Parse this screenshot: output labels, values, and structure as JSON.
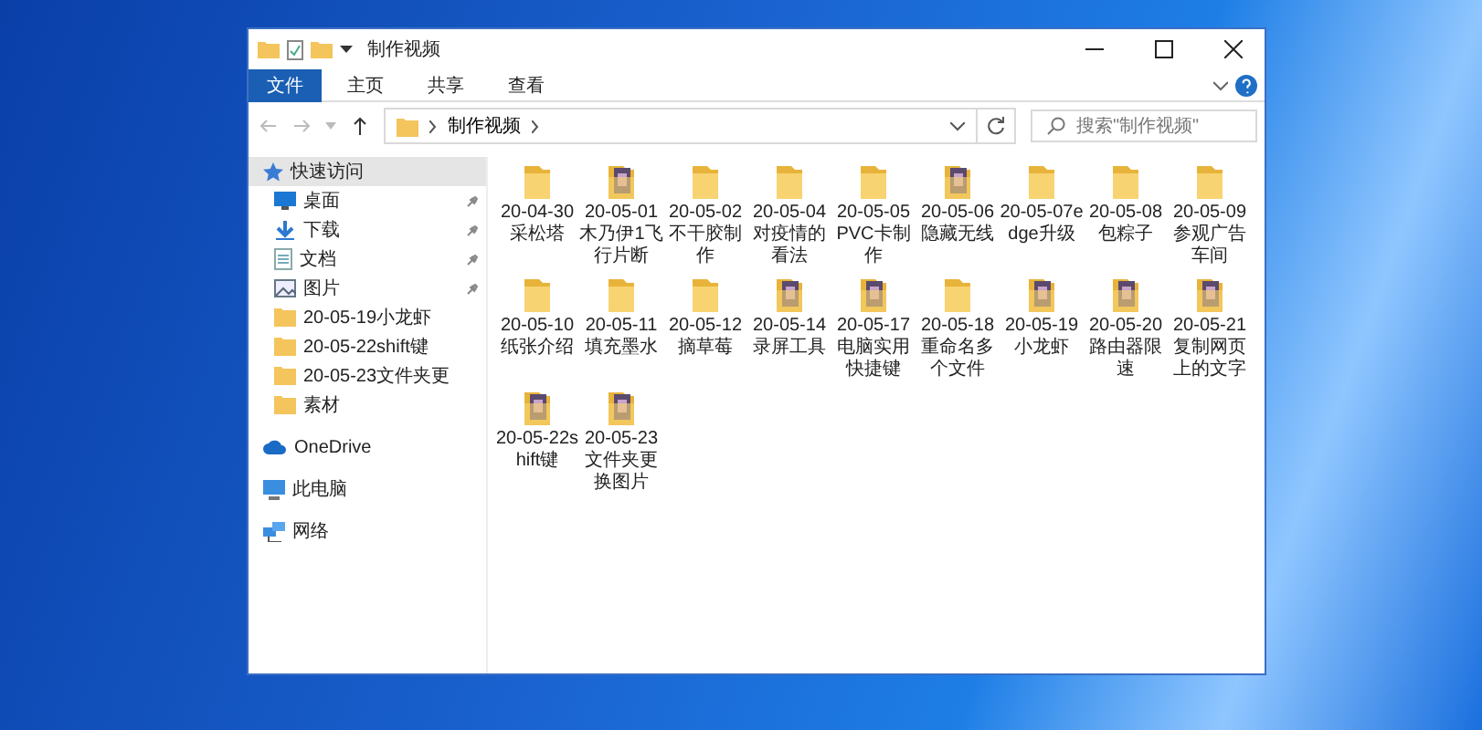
{
  "window": {
    "title": "制作视频"
  },
  "ribbon_tabs": [
    {
      "label": "文件",
      "selected": true
    },
    {
      "label": "主页",
      "selected": false
    },
    {
      "label": "共享",
      "selected": false
    },
    {
      "label": "查看",
      "selected": false
    }
  ],
  "address": {
    "path": "制作视频"
  },
  "search": {
    "placeholder": "搜索\"制作视频\""
  },
  "sidebar": {
    "items": [
      {
        "kind": "quick",
        "label": "快速访问",
        "pinned": false,
        "selected": true
      },
      {
        "kind": "desktop",
        "label": "桌面",
        "pinned": true,
        "selected": false
      },
      {
        "kind": "download",
        "label": "下载",
        "pinned": true,
        "selected": false
      },
      {
        "kind": "docs",
        "label": "文档",
        "pinned": true,
        "selected": false
      },
      {
        "kind": "pictures",
        "label": "图片",
        "pinned": true,
        "selected": false
      },
      {
        "kind": "folder",
        "label": "20-05-19小龙虾",
        "pinned": false,
        "selected": false
      },
      {
        "kind": "folder",
        "label": "20-05-22shift键",
        "pinned": false,
        "selected": false
      },
      {
        "kind": "folder",
        "label": "20-05-23文件夹更",
        "pinned": false,
        "selected": false
      },
      {
        "kind": "folder",
        "label": "素材",
        "pinned": false,
        "selected": false
      },
      {
        "kind": "onedrive",
        "label": "OneDrive",
        "pinned": false,
        "selected": false
      },
      {
        "kind": "pc",
        "label": "此电脑",
        "pinned": false,
        "selected": false
      },
      {
        "kind": "network",
        "label": "网络",
        "pinned": false,
        "selected": false
      }
    ]
  },
  "files": [
    {
      "kind": "folder",
      "name": "20-04-30采松塔"
    },
    {
      "kind": "thumb",
      "name": "20-05-01木乃伊1飞行片断"
    },
    {
      "kind": "folder",
      "name": "20-05-02不干胶制作"
    },
    {
      "kind": "folder",
      "name": "20-05-04对疫情的看法"
    },
    {
      "kind": "folder",
      "name": "20-05-05PVC卡制作"
    },
    {
      "kind": "thumb",
      "name": "20-05-06隐藏无线"
    },
    {
      "kind": "folder",
      "name": "20-05-07edge升级"
    },
    {
      "kind": "folder",
      "name": "20-05-08包粽子"
    },
    {
      "kind": "folder",
      "name": "20-05-09参观广告车间"
    },
    {
      "kind": "folder",
      "name": "20-05-10纸张介绍"
    },
    {
      "kind": "folder",
      "name": "20-05-11填充墨水"
    },
    {
      "kind": "folder",
      "name": "20-05-12摘草莓"
    },
    {
      "kind": "thumb",
      "name": "20-05-14录屏工具"
    },
    {
      "kind": "thumb",
      "name": "20-05-17电脑实用快捷键"
    },
    {
      "kind": "folder",
      "name": "20-05-18重命名多个文件"
    },
    {
      "kind": "thumb",
      "name": "20-05-19小龙虾"
    },
    {
      "kind": "thumb",
      "name": "20-05-20路由器限速"
    },
    {
      "kind": "thumb",
      "name": "20-05-21复制网页上的文字"
    },
    {
      "kind": "thumb",
      "name": "20-05-22shift键"
    },
    {
      "kind": "thumb",
      "name": "20-05-23文件夹更换图片"
    }
  ]
}
